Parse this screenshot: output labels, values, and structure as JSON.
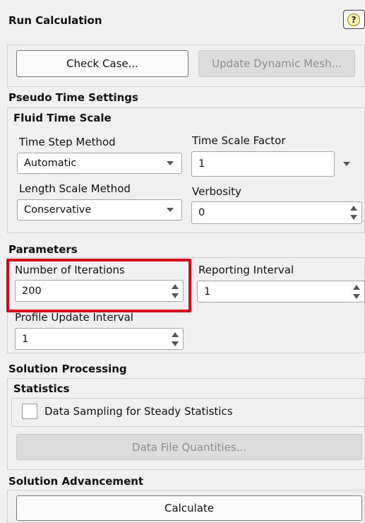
{
  "title": "Run Calculation",
  "help_glyph": "?",
  "buttons": {
    "check_case": "Check Case...",
    "update_dynamic_mesh": "Update Dynamic Mesh..."
  },
  "pseudo_time": {
    "header": "Pseudo Time Settings",
    "fluid_time_scale": "Fluid Time Scale",
    "time_step_method_label": "Time Step Method",
    "time_step_method_value": "Automatic",
    "time_scale_factor_label": "Time Scale Factor",
    "time_scale_factor_value": "1",
    "length_scale_method_label": "Length Scale Method",
    "length_scale_method_value": "Conservative",
    "verbosity_label": "Verbosity",
    "verbosity_value": "0"
  },
  "parameters": {
    "header": "Parameters",
    "iterations_label": "Number of Iterations",
    "iterations_value": "200",
    "reporting_interval_label": "Reporting Interval",
    "reporting_interval_value": "1",
    "profile_update_label": "Profile Update Interval",
    "profile_update_value": "1"
  },
  "solution_processing": {
    "header": "Solution Processing",
    "statistics_header": "Statistics",
    "data_sampling_label": "Data Sampling for Steady Statistics",
    "data_sampling_checked": false,
    "data_file_quantities": "Data File Quantities..."
  },
  "solution_advancement": {
    "header": "Solution Advancement",
    "calculate": "Calculate"
  },
  "colors": {
    "highlight": "#e3001b",
    "background": "#f0f0f0",
    "disabled_text": "#8d8d8d"
  }
}
